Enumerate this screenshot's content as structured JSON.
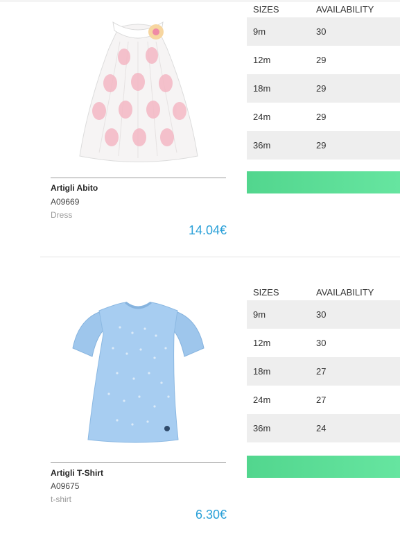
{
  "products": [
    {
      "name": "Artigli Abito",
      "code": "A09669",
      "category": "Dress",
      "price": "14.04€",
      "image_icon": "pink-polka-dot-dress-image",
      "table_headers": {
        "sizes": "SIZES",
        "availability": "AVAILABILITY"
      },
      "sizes": [
        {
          "size": "9m",
          "qty": "30"
        },
        {
          "size": "12m",
          "qty": "29"
        },
        {
          "size": "18m",
          "qty": "29"
        },
        {
          "size": "24m",
          "qty": "29"
        },
        {
          "size": "36m",
          "qty": "29"
        }
      ]
    },
    {
      "name": "Artigli T-Shirt",
      "code": "A09675",
      "category": "t-shirt",
      "price": "6.30€",
      "image_icon": "blue-tshirt-image",
      "table_headers": {
        "sizes": "SIZES",
        "availability": "AVAILABILITY"
      },
      "sizes": [
        {
          "size": "9m",
          "qty": "30"
        },
        {
          "size": "12m",
          "qty": "30"
        },
        {
          "size": "18m",
          "qty": "27"
        },
        {
          "size": "24m",
          "qty": "27"
        },
        {
          "size": "36m",
          "qty": "24"
        }
      ]
    }
  ],
  "colors": {
    "price": "#2aa0d8",
    "button": "#5ade96",
    "row_alt": "#eeeeee"
  }
}
